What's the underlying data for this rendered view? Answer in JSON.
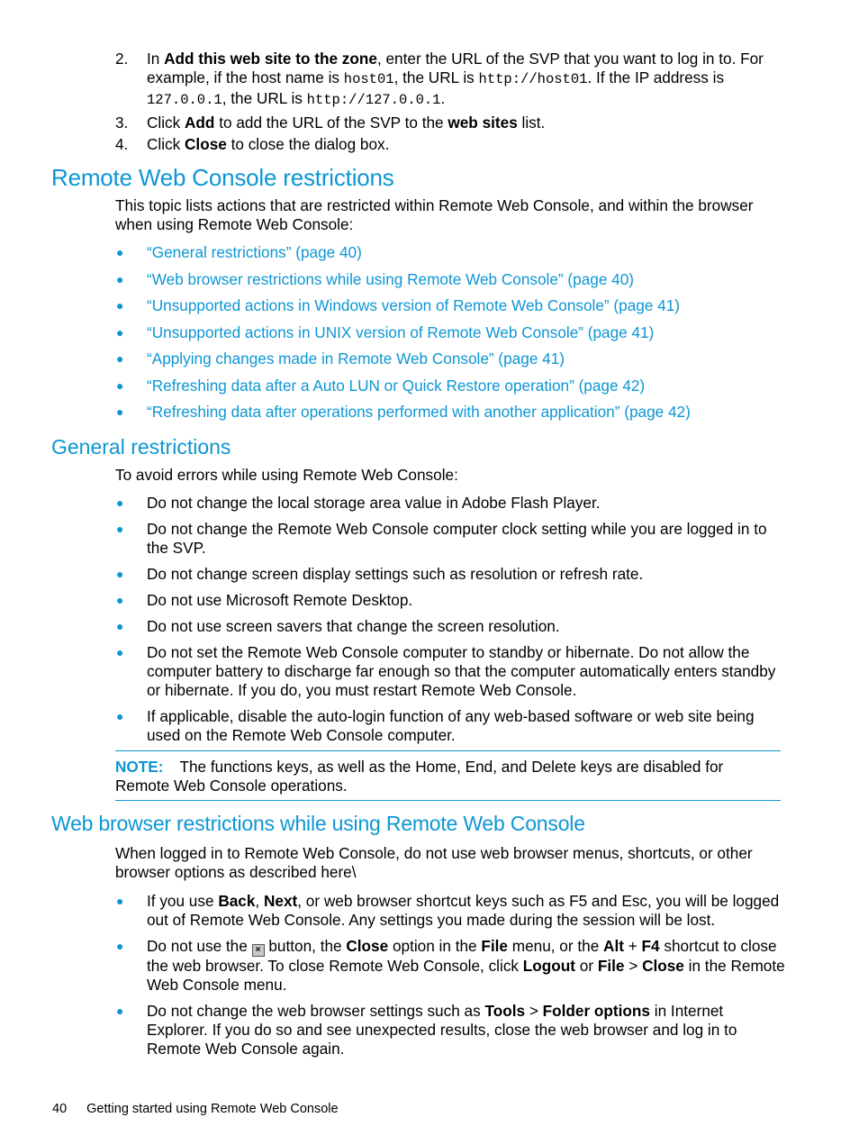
{
  "steps": [
    {
      "number": "2.",
      "parts": {
        "t1": "In ",
        "b1": "Add this web site to the zone",
        "t2": ", enter the URL of the SVP that you want to log in to. For example, if the host name is ",
        "c1": "host01",
        "t3": ", the URL is ",
        "c2": "http://host01",
        "t4": ". If the IP address is ",
        "c3": "127.0.0.1",
        "t5": ", the URL is ",
        "c4": "http://127.0.0.1",
        "t6": "."
      }
    },
    {
      "number": "3.",
      "parts": {
        "t1": "Click ",
        "b1": "Add",
        "t2": " to add the URL of the SVP to the ",
        "b2": "web sites",
        "t3": " list."
      }
    },
    {
      "number": "4.",
      "parts": {
        "t1": "Click ",
        "b1": "Close",
        "t2": " to close the dialog box."
      }
    }
  ],
  "section_main": {
    "title": "Remote Web Console restrictions",
    "intro": "This topic lists actions that are restricted within Remote Web Console, and within the browser when using Remote Web Console:",
    "links": [
      "“General restrictions” (page 40)",
      "“Web browser restrictions while using Remote Web Console” (page 40)",
      "“Unsupported actions in Windows version of Remote Web Console” (page 41)",
      "“Unsupported actions in UNIX version of Remote Web Console” (page 41)",
      "“Applying changes made in Remote Web Console” (page 41)",
      "“Refreshing data after a Auto LUN or Quick Restore operation” (page 42)",
      "“Refreshing data after operations performed with another application” (page 42)"
    ]
  },
  "section_general": {
    "title": "General restrictions",
    "intro": "To avoid errors while using Remote Web Console:",
    "items": [
      "Do not change the local storage area value in Adobe Flash Player.",
      "Do not change the Remote Web Console computer clock setting while you are logged in to the SVP.",
      "Do not change screen display settings such as resolution or refresh rate.",
      "Do not use Microsoft Remote Desktop.",
      "Do not use screen savers that change the screen resolution.",
      "Do not set the Remote Web Console computer to standby or hibernate. Do not allow the computer battery to discharge far enough so that the computer automatically enters standby or hibernate. If you do, you must restart Remote Web Console.",
      "If applicable, disable the auto-login function of any web-based software or web site being used on the Remote Web Console computer."
    ],
    "note_label": "NOTE:",
    "note_text": "The functions keys, as well as the Home, End, and Delete keys are disabled for Remote Web Console operations."
  },
  "section_web": {
    "title": "Web browser restrictions while using Remote Web Console",
    "intro": "When logged in to Remote Web Console, do not use web browser menus, shortcuts, or other browser options as described here\\",
    "item1": {
      "t1": "If you use ",
      "b1": "Back",
      "t2": ", ",
      "b2": "Next",
      "t3": ", or web browser shortcut keys such as F5 and Esc, you will be logged out of Remote Web Console. Any settings you made during the session will be lost."
    },
    "item2": {
      "t1": "Do not use the ",
      "icon": "×",
      "t2": " button, the ",
      "b1": "Close",
      "t3": " option in the ",
      "b2": "File",
      "t4": " menu, or the ",
      "b3": "Alt",
      "t5": " + ",
      "b4": "F4",
      "t6": " shortcut to close the web browser. To close Remote Web Console, click ",
      "b5": "Logout",
      "t7": " or ",
      "b6": "File",
      "t8": " > ",
      "b7": "Close",
      "t9": " in the Remote Web Console menu."
    },
    "item3": {
      "t1": "Do not change the web browser settings such as ",
      "b1": "Tools",
      "t2": " > ",
      "b2": "Folder options",
      "t3": " in Internet Explorer. If you do so and see unexpected results, close the web browser and log in to Remote Web Console again."
    }
  },
  "footer": {
    "page_number": "40",
    "chapter": "Getting started using Remote Web Console"
  },
  "colors": {
    "accent": "#0d96d4",
    "text": "#000000"
  }
}
